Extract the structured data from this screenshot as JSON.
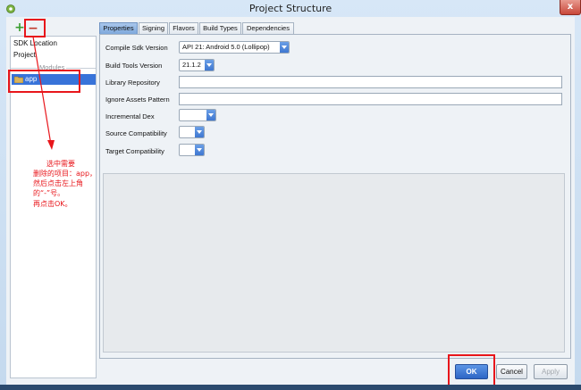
{
  "window": {
    "title": "Project Structure",
    "close_label": "x"
  },
  "toolbar": {
    "add_label": "+",
    "remove_label": "−"
  },
  "left_panel": {
    "items": [
      "SDK Location",
      "Project"
    ],
    "modules_header": "Modules",
    "selected_module": "app"
  },
  "tabs": [
    "Properties",
    "Signing",
    "Flavors",
    "Build Types",
    "Dependencies"
  ],
  "properties": {
    "compile_sdk": {
      "label": "Compile Sdk Version",
      "value": "API 21: Android 5.0 (Lollipop)"
    },
    "build_tools": {
      "label": "Build Tools Version",
      "value": "21.1.2"
    },
    "library_repository": {
      "label": "Library Repository",
      "value": ""
    },
    "ignore_assets": {
      "label": "Ignore Assets Pattern",
      "value": ""
    },
    "incremental_dex": {
      "label": "Incremental Dex",
      "value": ""
    },
    "source_compat": {
      "label": "Source Compatibility",
      "value": ""
    },
    "target_compat": {
      "label": "Target Compatibility",
      "value": ""
    }
  },
  "buttons": {
    "ok": "OK",
    "cancel": "Cancel",
    "apply": "Apply"
  },
  "annotation": {
    "lines": [
      "选中需要",
      "删除的项目：app，",
      "然后点击左上角",
      "的“-”号。",
      "再点击OK。"
    ]
  },
  "colors": {
    "accent": "#3873d9",
    "annotation": "#e8161b"
  }
}
